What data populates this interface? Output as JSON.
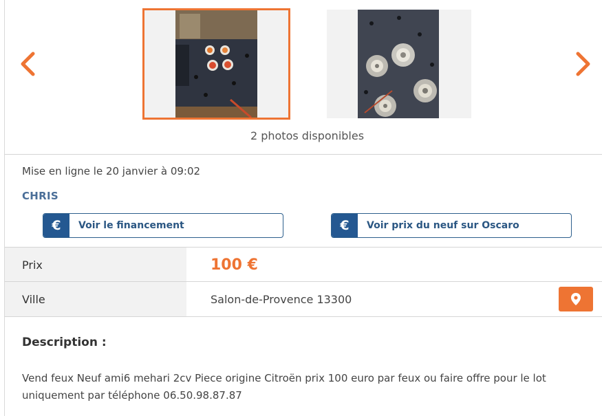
{
  "gallery": {
    "photos_count": "2 photos disponibles",
    "accent": "#ee7433"
  },
  "listing": {
    "posted": "Mise en ligne le 20 janvier à 09:02",
    "seller": "CHRIS",
    "buttons": {
      "financing": "Voir le financement",
      "oscaro": "Voir prix du neuf sur Oscaro",
      "euro_symbol": "€"
    },
    "price_label": "Prix",
    "price_value": "100 €",
    "city_label": "Ville",
    "city_value": "Salon-de-Provence 13300",
    "description_title": "Description :",
    "description_text": "Vend feux Neuf ami6 mehari 2cv Piece origine Citroën prix 100 euro par feux ou faire offre pour le lot uniquement par téléphone 06.50.98.87.87"
  }
}
